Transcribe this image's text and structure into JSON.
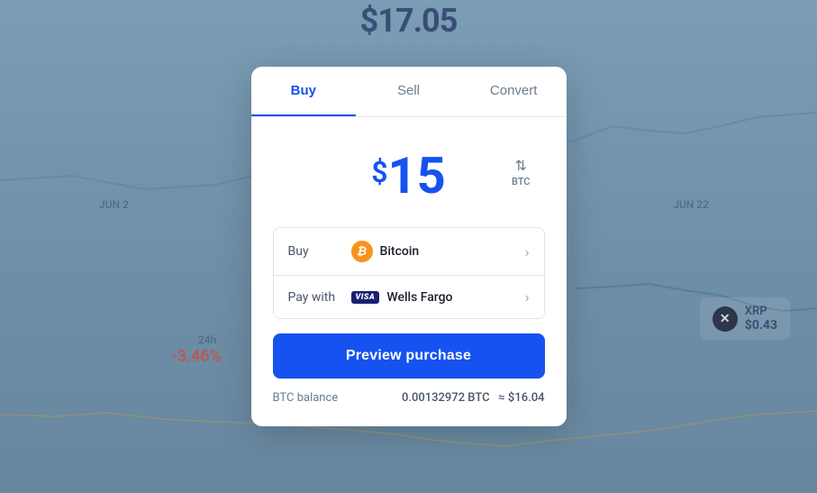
{
  "background": {
    "price": "$17.05",
    "jun2_label": "JUN 2",
    "jun22_label": "JUN 22",
    "timeframe": "24h",
    "percent_change": "-3.46%",
    "xrp": {
      "name": "XRP",
      "price": "$0.43",
      "icon_char": "✕"
    }
  },
  "modal": {
    "tabs": [
      {
        "label": "Buy",
        "id": "buy",
        "active": true
      },
      {
        "label": "Sell",
        "id": "sell",
        "active": false
      },
      {
        "label": "Convert",
        "id": "convert",
        "active": false
      }
    ],
    "amount": {
      "dollar_sign": "$",
      "value": "15",
      "currency_code": "BTC",
      "toggle_icon": "⇅"
    },
    "options": [
      {
        "label": "Buy",
        "asset_name": "Bitcoin",
        "icon_char": "₿"
      },
      {
        "label": "Pay with",
        "payment_name": "Wells Fargo",
        "visa_text": "VISA"
      }
    ],
    "preview_button_label": "Preview purchase",
    "balance": {
      "label": "BTC balance",
      "value": "0.00132972 BTC",
      "approx": "≈ $16.04"
    }
  }
}
